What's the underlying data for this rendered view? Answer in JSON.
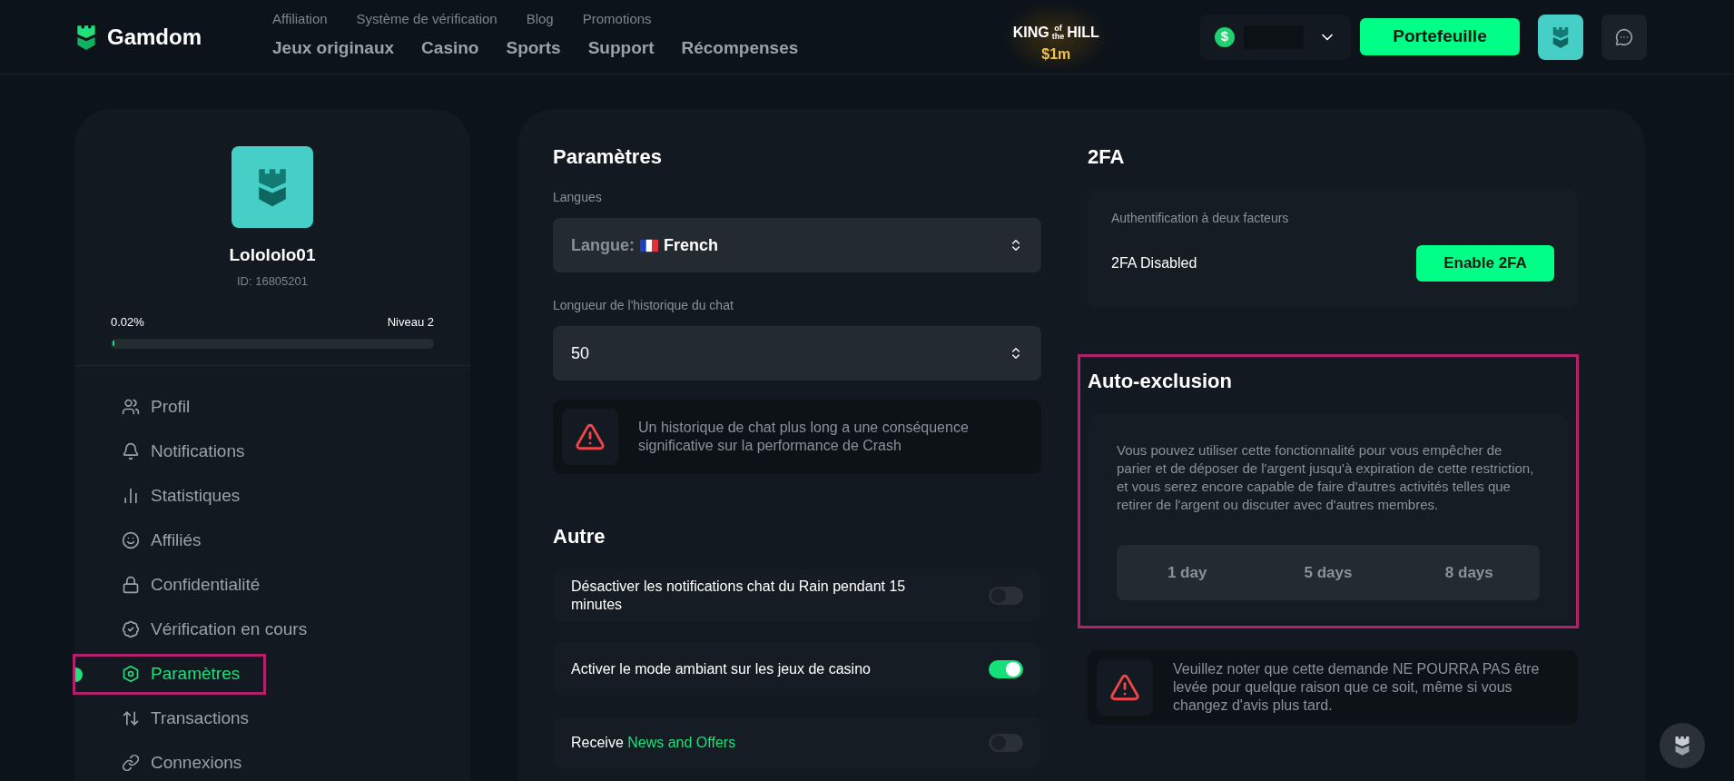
{
  "header": {
    "brand": "Gamdom",
    "top_links": [
      "Affiliation",
      "Système de vérification",
      "Blog",
      "Promotions"
    ],
    "nav": [
      "Jeux originaux",
      "Casino",
      "Sports",
      "Support",
      "Récompenses"
    ],
    "promo": {
      "left": "KING",
      "of": "of",
      "the": "the",
      "right": "HILL",
      "amount": "$1m"
    },
    "currency_symbol": "$",
    "wallet_button": "Portefeuille"
  },
  "sidebar": {
    "username": "Lolololo01",
    "user_id": "ID: 16805201",
    "progress": "0.02%",
    "level_label": "Niveau 2",
    "level": 0.004,
    "items": [
      {
        "label": "Profil",
        "selected": false,
        "highlighted": false
      },
      {
        "label": "Notifications",
        "selected": false,
        "highlighted": false
      },
      {
        "label": "Statistiques",
        "selected": false,
        "highlighted": false
      },
      {
        "label": "Affiliés",
        "selected": false,
        "highlighted": false
      },
      {
        "label": "Confidentialité",
        "selected": false,
        "highlighted": false
      },
      {
        "label": "Vérification en cours",
        "selected": false,
        "highlighted": false
      },
      {
        "label": "Paramètres",
        "selected": true,
        "highlighted": true
      },
      {
        "label": "Transactions",
        "selected": false,
        "highlighted": false
      },
      {
        "label": "Connexions",
        "selected": false,
        "highlighted": false
      }
    ]
  },
  "settings": {
    "title": "Paramètres",
    "language": {
      "label": "Langues",
      "prefix": "Langue:",
      "value": "French"
    },
    "chat_history": {
      "label": "Longueur de l'historique du chat",
      "value": "50"
    },
    "warning": "Un historique de chat plus long a une conséquence significative sur la performance de Crash",
    "other_title": "Autre",
    "toggles": [
      {
        "label": "Désactiver les notifications chat du Rain pendant 15 minutes",
        "on": false
      },
      {
        "label": "Activer le mode ambiant sur les jeux de casino",
        "on": true
      },
      {
        "label": "Receive",
        "link": "News and Offers",
        "on": false
      }
    ]
  },
  "twofa": {
    "title": "2FA",
    "label": "Authentification à deux facteurs",
    "status": "2FA Disabled",
    "button": "Enable 2FA"
  },
  "self_exclusion": {
    "title": "Auto-exclusion",
    "highlighted": true,
    "description": "Vous pouvez utiliser cette fonctionnalité pour vous empêcher de parier et de déposer de l'argent jusqu'à expiration de cette restriction, et vous serez encore capable de faire d'autres activités telles que retirer de l'argent ou discuter avec d'autres membres.",
    "options": [
      {
        "label": "1 day",
        "selected": false
      },
      {
        "label": "5 days",
        "selected": false
      },
      {
        "label": "8 days",
        "selected": false
      }
    ],
    "warning": "Veuillez noter que cette demande NE POURRA PAS être levée pour quelque raison que ce soit, même si vous changez d'avis plus tard."
  }
}
